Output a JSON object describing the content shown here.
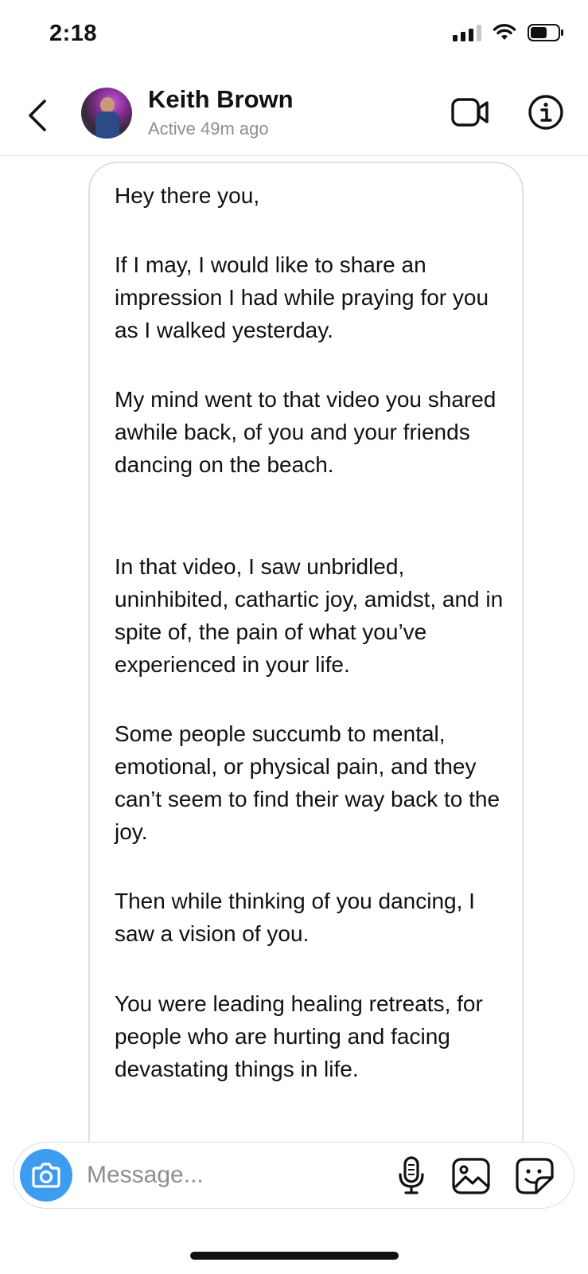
{
  "status_bar": {
    "time": "2:18",
    "icons": [
      "cellular-signal-icon",
      "wifi-icon",
      "battery-icon"
    ],
    "signal_bars_active": 3,
    "signal_bars_total": 4,
    "battery_level": 0.6
  },
  "header": {
    "back_icon": "chevron-left-icon",
    "contact_name": "Keith Brown",
    "contact_status": "Active 49m ago",
    "video_icon": "video-camera-icon",
    "info_icon": "info-icon"
  },
  "message": {
    "paragraphs": [
      "Hey there you,",
      "If I may, I would like to share an impression I had while praying for you as I walked yesterday.",
      "My mind went to that video you shared awhile back, of you and your friends dancing on the beach.",
      "In that video, I saw unbridled, uninhibited, cathartic joy, amidst, and in spite of, the pain of what you’ve experienced in your life.",
      "Some people succumb to mental, emotional, or physical pain, and they can’t seem to find their way back to the joy.",
      "Then while thinking of you dancing, I saw a vision of you.",
      "You were leading healing retreats, for people who are hurting and facing devastating things in life."
    ]
  },
  "composer": {
    "placeholder": "Message...",
    "camera_icon": "camera-icon",
    "mic_icon": "microphone-icon",
    "gallery_icon": "gallery-icon",
    "sticker_icon": "sticker-icon"
  },
  "colors": {
    "accent": "#3d9bf0",
    "text": "#111111",
    "muted": "#8e8e8e",
    "border": "#e0e0e0"
  }
}
